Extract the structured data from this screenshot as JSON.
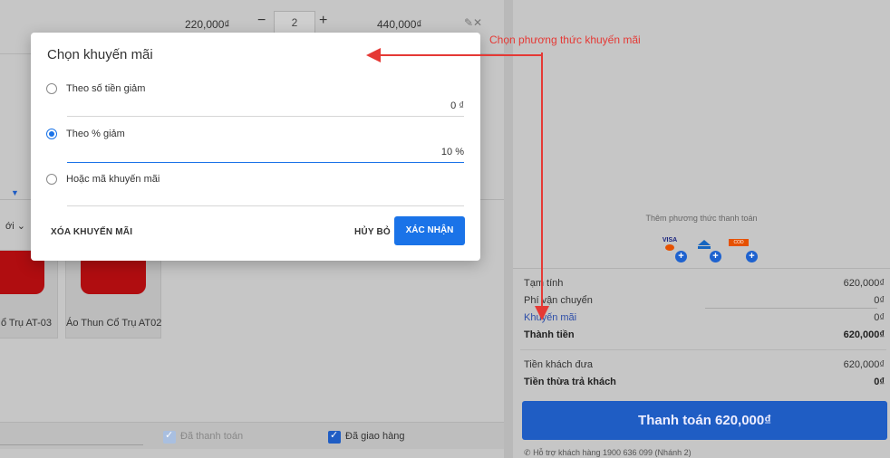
{
  "order_line": {
    "unit_price": "220,000₫",
    "quantity": "2",
    "line_total": "440,000₫",
    "minus": "−",
    "plus": "+",
    "edit_remove": "✎✕"
  },
  "products": {
    "filter_fragment": "ới ⌄",
    "cards": [
      {
        "name": "ổ Trụ AT-03"
      },
      {
        "name": "Áo Thun Cổ Trụ AT02"
      }
    ]
  },
  "bottom_bar": {
    "paid_label": "Đã thanh toán",
    "delivered_label": "Đã giao hàng"
  },
  "payment_methods": {
    "title": "Thêm phương thức thanh toán",
    "icons": [
      "visa-card-icon",
      "bank-transfer-icon",
      "cod-icon"
    ],
    "visa_text": "VISA",
    "cod_text": "COD"
  },
  "summary": {
    "subtotal_label": "Tạm tính",
    "subtotal": "620,000₫",
    "shipping_label": "Phí vận chuyển",
    "shipping": "0₫",
    "promo_label": "Khuyến mãi",
    "promo": "0₫",
    "total_label": "Thành tiền",
    "total": "620,000₫",
    "paid_label": "Tiền khách đưa",
    "paid": "620,000₫",
    "change_label": "Tiền thừa trả khách",
    "change": "0₫"
  },
  "pay_button": "Thanh toán 620,000₫",
  "support_text": "Hỗ trợ khách hàng 1900 636 099 (Nhánh 2)",
  "modal": {
    "title": "Chọn khuyến mãi",
    "options": [
      {
        "label": "Theo số tiền giảm",
        "value": "0 ₫",
        "selected": false
      },
      {
        "label": "Theo % giảm",
        "value": "10 %",
        "selected": true
      },
      {
        "label": "Hoặc mã khuyến mãi",
        "value": "",
        "selected": false
      }
    ],
    "clear_button": "XÓA KHUYẾN MÃI",
    "cancel_button": "HỦY BỎ",
    "confirm_button": "XÁC NHẬN"
  },
  "annotation": {
    "text": "Chọn phương thức khuyến mãi",
    "color": "#e53935"
  },
  "colors": {
    "accent": "#1a73e8",
    "pay_button": "#1f5dc4",
    "overlay": "#c6c6c6"
  }
}
